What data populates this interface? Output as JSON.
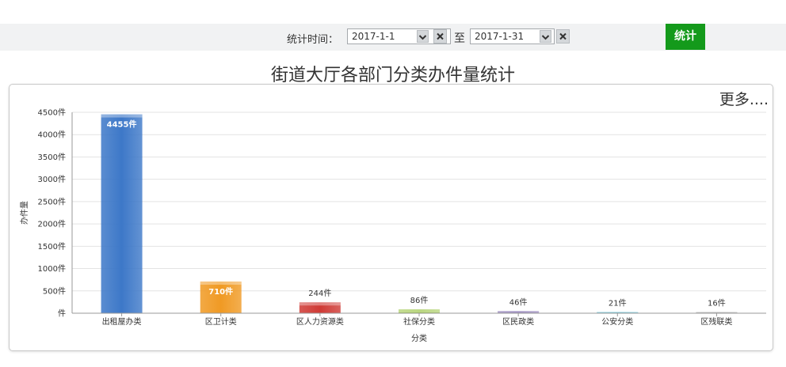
{
  "filter": {
    "label": "统计时间：",
    "start_date": "2017-1-1",
    "end_date": "2017-1-31",
    "to_label": "至",
    "submit_label": "统计"
  },
  "more_link": "更多....",
  "colors": {
    "accent": "#149a1b",
    "bar_colors": [
      "#3d78c8",
      "#f09a24",
      "#cf3a35",
      "#95c13d",
      "#7058a3",
      "#3cadc6",
      "#999999"
    ]
  },
  "chart_data": {
    "type": "bar",
    "title": "街道大厅各部门分类办件量统计",
    "xlabel": "分类",
    "ylabel": "办件量",
    "ylim": [
      0,
      4500
    ],
    "unit": "件",
    "yticks": [
      "件",
      "500件",
      "1000件",
      "1500件",
      "2000件",
      "2500件",
      "3000件",
      "3500件",
      "4000件",
      "4500件"
    ],
    "grid": true,
    "categories": [
      "出租屋办类",
      "区卫计类",
      "区人力资源类",
      "社保分类",
      "区民政类",
      "公安分类",
      "区残联类"
    ],
    "values": [
      4455,
      710,
      244,
      86,
      46,
      21,
      16
    ],
    "value_labels": [
      "4455件",
      "710件",
      "244件",
      "86件",
      "46件",
      "21件",
      "16件"
    ]
  }
}
